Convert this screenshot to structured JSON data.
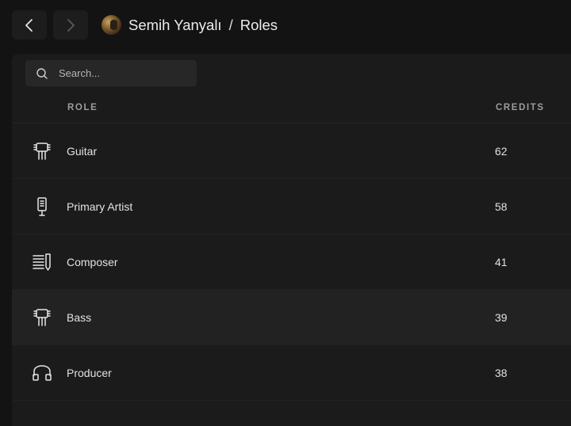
{
  "header": {
    "artist_name": "Semih Yanyalı",
    "separator": "/",
    "page_title": "Roles",
    "back_icon": "chevron-left-icon",
    "forward_icon": "chevron-right-icon"
  },
  "search": {
    "placeholder": "Search...",
    "value": "",
    "icon": "search-icon"
  },
  "table": {
    "columns": [
      "ROLE",
      "CREDITS"
    ],
    "rows": [
      {
        "role": "Guitar",
        "credits": "62",
        "icon": "guitar-icon",
        "highlighted": false
      },
      {
        "role": "Primary Artist",
        "credits": "58",
        "icon": "microphone-icon",
        "highlighted": false
      },
      {
        "role": "Composer",
        "credits": "41",
        "icon": "composer-icon",
        "highlighted": false
      },
      {
        "role": "Bass",
        "credits": "39",
        "icon": "bass-icon",
        "highlighted": true
      },
      {
        "role": "Producer",
        "credits": "38",
        "icon": "headphones-icon",
        "highlighted": false
      }
    ]
  },
  "colors": {
    "background": "#131313",
    "panel": "#1b1b1b",
    "highlight_row": "#222222",
    "text": "#e2e2e2",
    "muted": "#9c9c9c"
  }
}
